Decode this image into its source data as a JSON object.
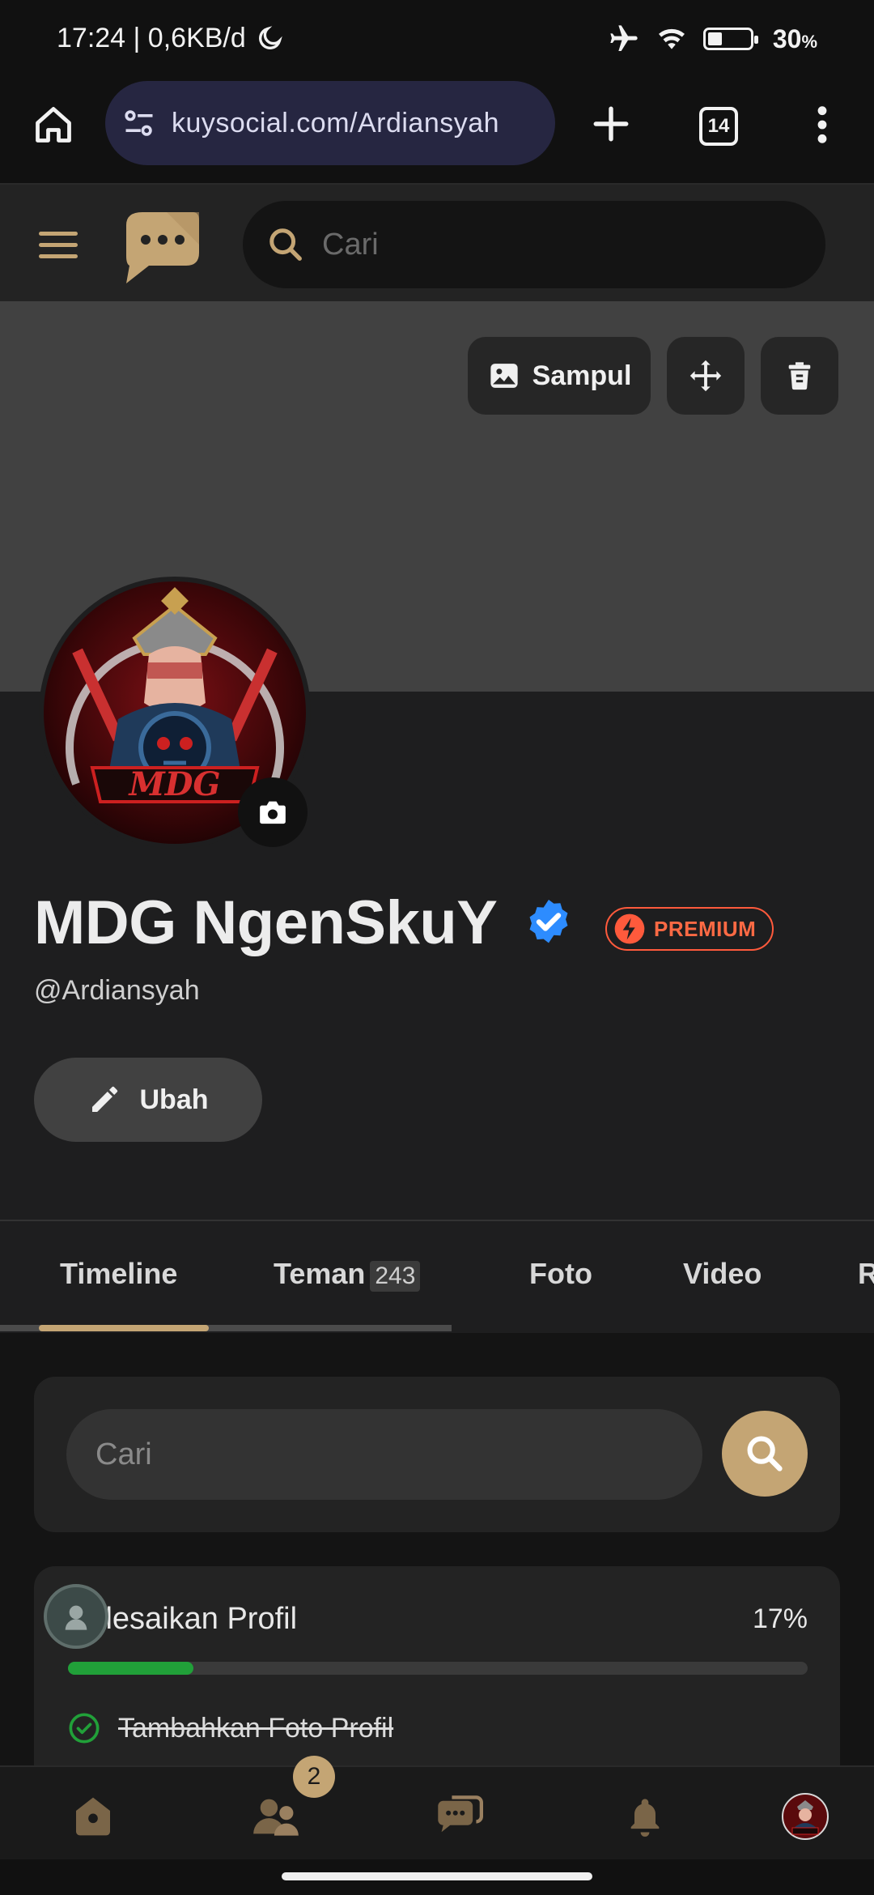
{
  "status_bar": {
    "time": "17:24 | 0,6KB/d",
    "battery": "30",
    "battery_unit": "%",
    "icons": [
      "moon-icon",
      "airplane-icon",
      "wifi-icon",
      "battery-icon"
    ]
  },
  "browser": {
    "url": "kuysocial.com/Ardiansyah",
    "tab_count": "14",
    "icons": [
      "home-icon",
      "site-settings-icon",
      "new-tab-icon",
      "tabs-icon",
      "more-vert-icon"
    ]
  },
  "header": {
    "search_placeholder": "Cari",
    "icons": [
      "menu-icon",
      "chat-logo-icon",
      "search-icon"
    ]
  },
  "cover": {
    "cover_label": "Sampul"
  },
  "profile": {
    "name": "MDG NgenSkuY",
    "premium_label": "PREMIUM",
    "handle": "@Ardiansyah",
    "edit_label": "Ubah"
  },
  "tabs": [
    {
      "label": "Timeline",
      "count": ""
    },
    {
      "label": "Teman",
      "count": "243"
    },
    {
      "label": "Foto",
      "count": ""
    },
    {
      "label": "Video",
      "count": ""
    },
    {
      "label": "R",
      "count": ""
    }
  ],
  "timeline_search": {
    "placeholder": "Cari"
  },
  "profile_progress": {
    "title": "Selesaikan Profil",
    "percent_label": "17%",
    "percent_value": 17,
    "tasks": [
      {
        "label": "Tambahkan Foto Profil",
        "done": true
      }
    ]
  },
  "bottom_nav": {
    "friends_badge": "2",
    "items": [
      "home-icon",
      "friends-icon",
      "messages-icon",
      "notifications-icon",
      "profile-avatar"
    ]
  },
  "colors": {
    "accent": "#c4a574",
    "premium": "#ff5a3c",
    "verified": "#2d8cff",
    "progress": "#21a039"
  }
}
